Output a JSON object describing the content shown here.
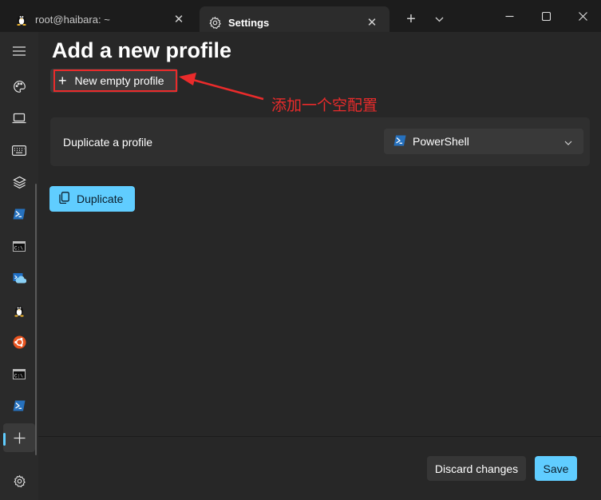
{
  "tabs": [
    {
      "title": "root@haibara: ~",
      "icon": "linux-penguin-icon"
    },
    {
      "title": "Settings",
      "icon": "gear-icon"
    }
  ],
  "page": {
    "title": "Add a new profile",
    "new_empty_profile_label": "New empty profile",
    "duplicate_label": "Duplicate a profile",
    "duplicate_selected": "PowerShell",
    "duplicate_button": "Duplicate",
    "discard_label": "Discard changes",
    "save_label": "Save"
  },
  "annotation": {
    "text": "添加一个空配置",
    "color": "#ea2b2b"
  },
  "nav": {
    "items": [
      "hamburger-menu-icon",
      "palette-icon",
      "laptop-icon",
      "keyboard-icon",
      "layers-icon",
      "powershell-icon",
      "cmd-icon",
      "azure-cloud-shell-icon",
      "linux-penguin-icon",
      "ubuntu-icon",
      "cmd-icon",
      "powershell-icon",
      "add-profile-icon"
    ],
    "settings_icon": "gear-icon"
  },
  "colors": {
    "accent": "#60cdff",
    "background": "#272727",
    "sidebar": "#2a2a2a"
  }
}
